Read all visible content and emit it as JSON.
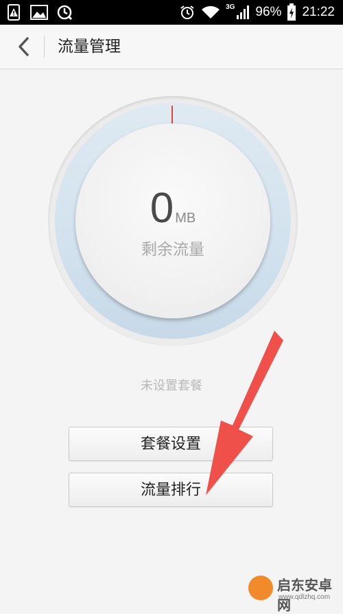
{
  "status_bar": {
    "network_label": "3G",
    "battery": "96%",
    "time": "21:22"
  },
  "header": {
    "title": "流量管理"
  },
  "gauge": {
    "value": "0",
    "unit": "MB",
    "label": "剩余流量"
  },
  "status_message": "未设置套餐",
  "buttons": {
    "plan_settings": "套餐设置",
    "traffic_ranking": "流量排行"
  },
  "watermark": {
    "brand": "启东安卓网",
    "url": "www.qdlzhq.com"
  },
  "colors": {
    "accent_marker": "#d9453b",
    "arrow": "#f0504a"
  }
}
